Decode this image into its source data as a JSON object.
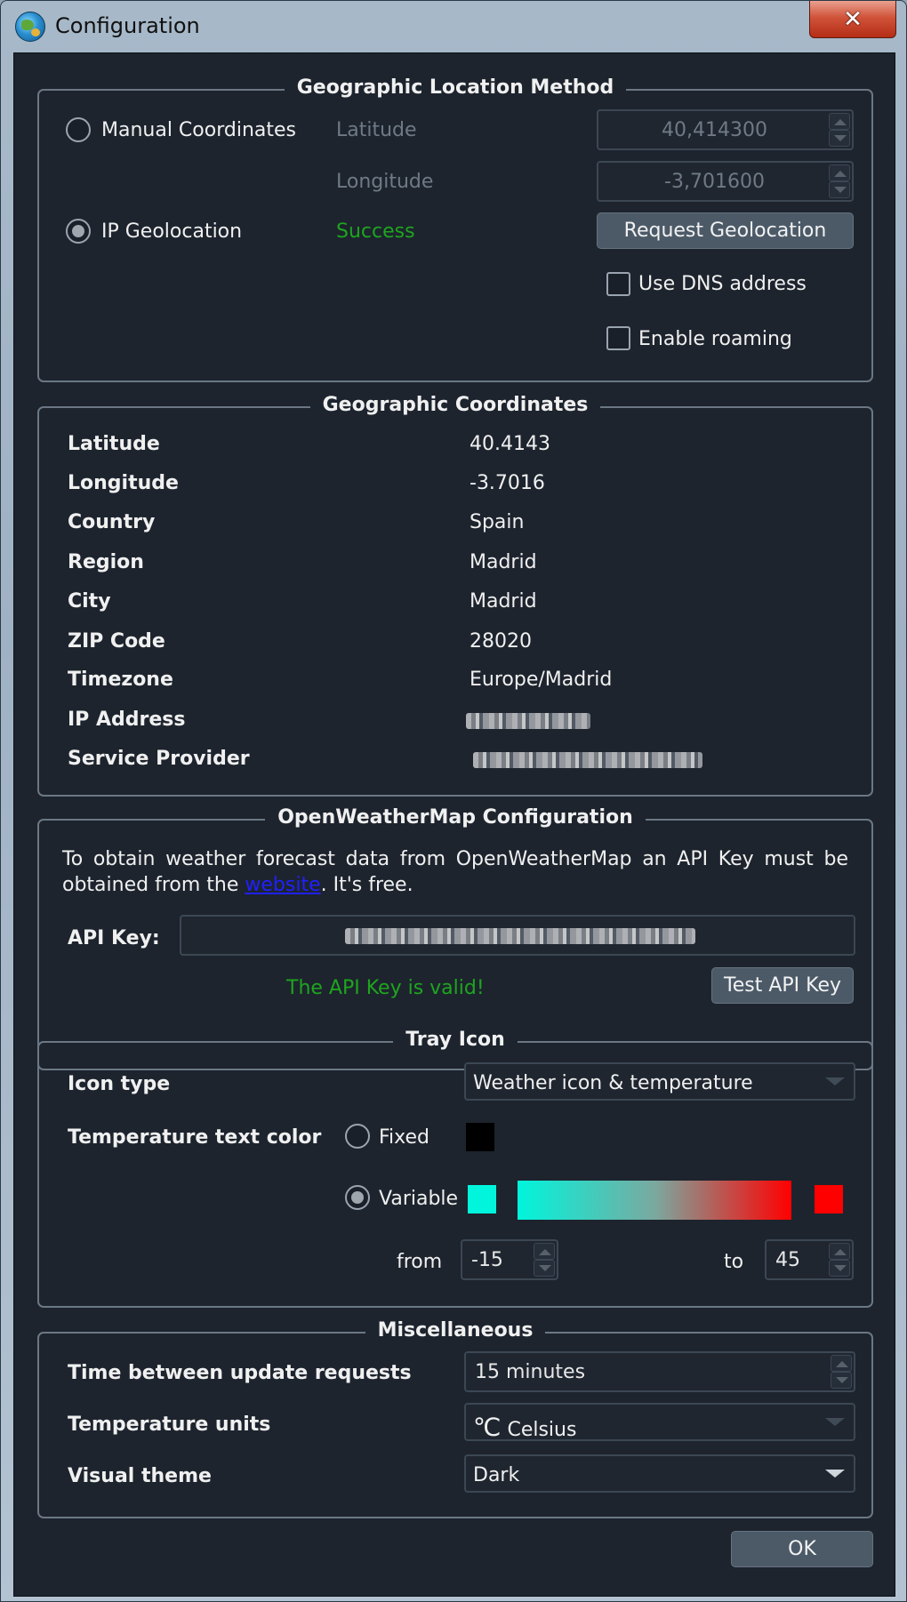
{
  "window": {
    "title": "Configuration",
    "close_glyph": "✕"
  },
  "geo_method": {
    "title": "Geographic Location Method",
    "manual_label": "Manual Coordinates",
    "ip_label": "IP Geolocation",
    "latitude_label": "Latitude",
    "longitude_label": "Longitude",
    "latitude_value": "40,414300",
    "longitude_value": "-3,701600",
    "status": "Success",
    "request_button": "Request Geolocation",
    "dns_label": "Use DNS address",
    "roaming_label": "Enable roaming",
    "selected": "IP Geolocation"
  },
  "coords": {
    "title": "Geographic Coordinates",
    "rows": [
      {
        "label": "Latitude",
        "value": "40.4143"
      },
      {
        "label": "Longitude",
        "value": "-3.7016"
      },
      {
        "label": "Country",
        "value": "Spain"
      },
      {
        "label": "Region",
        "value": "Madrid"
      },
      {
        "label": "City",
        "value": "Madrid"
      },
      {
        "label": "ZIP Code",
        "value": "28020"
      },
      {
        "label": "Timezone",
        "value": "Europe/Madrid"
      },
      {
        "label": "IP Address",
        "value": ""
      },
      {
        "label": "Service Provider",
        "value": ""
      }
    ]
  },
  "owm": {
    "title": "OpenWeatherMap Configuration",
    "text_before": "To obtain weather forecast data from OpenWeatherMap an API Key must be obtained from the ",
    "link_text": "website",
    "text_after": ". It's free.",
    "api_key_label": "API Key:",
    "status": "The API Key is valid!",
    "test_button": "Test API Key"
  },
  "tray": {
    "title": "Tray Icon",
    "icon_type_label": "Icon type",
    "icon_type_value": "Weather icon & temperature",
    "text_color_label": "Temperature text color",
    "fixed_label": "Fixed",
    "variable_label": "Variable",
    "from_label": "from",
    "to_label": "to",
    "from_value": "-15",
    "to_value": "45",
    "fixed_color": "#000000",
    "min_color": "#00f5dc",
    "max_color": "#ff0000",
    "selected": "Variable"
  },
  "misc": {
    "title": "Miscellaneous",
    "update_label": "Time between update requests",
    "update_value": "15 minutes",
    "units_label": "Temperature units",
    "units_value": "Celsius",
    "units_icon": "℃",
    "theme_label": "Visual theme",
    "theme_value": "Dark"
  },
  "ok_button": "OK"
}
